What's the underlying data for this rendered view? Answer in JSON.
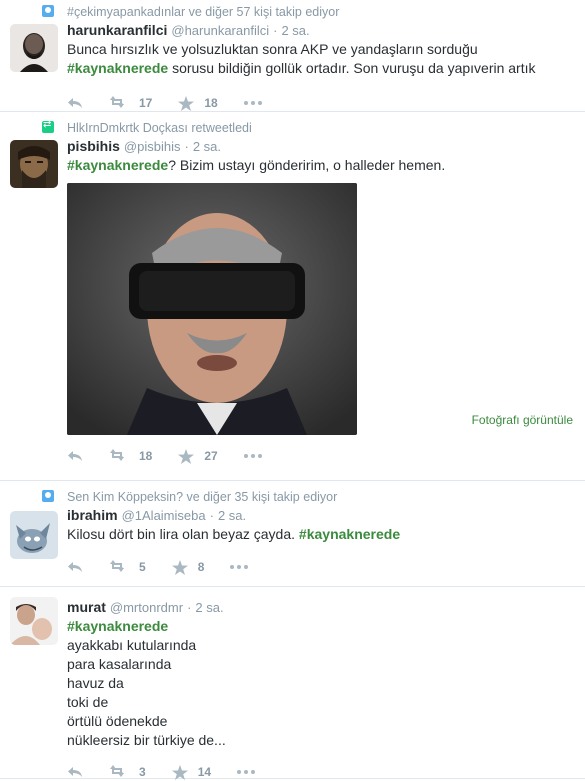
{
  "colors": {
    "accent": "#3b8a3e",
    "muted": "#8899a6",
    "icon": "#aab8c2",
    "text": "#292f33"
  },
  "tweets": [
    {
      "context": "#çekimyapankadınlar ve diğer 57 kişi takip ediyor",
      "context_icon": "person-icon",
      "fullname": "harunkaranfilci",
      "handle": "@harunkaranfilci",
      "time": "2 sa.",
      "text_plain": "Bunca hırsızlık ve yolsuzluktan sonra AKP ve yandaşların sorduğu",
      "hashtag": "#kaynaknerede",
      "text_after": " sorusu bildiğin gollük ortadır. Son vuruşu da yapıverin artık",
      "retweets": "17",
      "favorites": "18"
    },
    {
      "context": "HlkIrnDmkrtk Doçkası retweetledi",
      "context_icon": "retweet-icon",
      "fullname": "pisbihis",
      "handle": "@pisbihis",
      "time": "2 sa.",
      "hashtag": "#kaynaknerede",
      "text_after": "? Bizim ustayı gönderirim, o halleder hemen.",
      "retweets": "18",
      "favorites": "27",
      "view_photo": "Fotoğrafı görüntüle"
    },
    {
      "context": "Sen Kim Köppeksin? ve diğer 35 kişi takip ediyor",
      "context_icon": "person-icon",
      "fullname": "ibrahim",
      "handle": "@1Alaimiseba",
      "time": "2 sa.",
      "text_plain": "Kilosu dört bin lira olan beyaz çayda. ",
      "hashtag": "#kaynaknerede",
      "retweets": "5",
      "favorites": "8"
    },
    {
      "fullname": "murat",
      "handle": "@mrtonrdmr",
      "time": "2 sa.",
      "hashtag": "#kaynaknerede",
      "lines": [
        "ayakkabı kutularında",
        "para kasalarında",
        "havuz da",
        "toki de",
        "örtülü ödenekde",
        "nükleersiz bir türkiye de..."
      ],
      "retweets": "3",
      "favorites": "14"
    }
  ],
  "dot": "·"
}
